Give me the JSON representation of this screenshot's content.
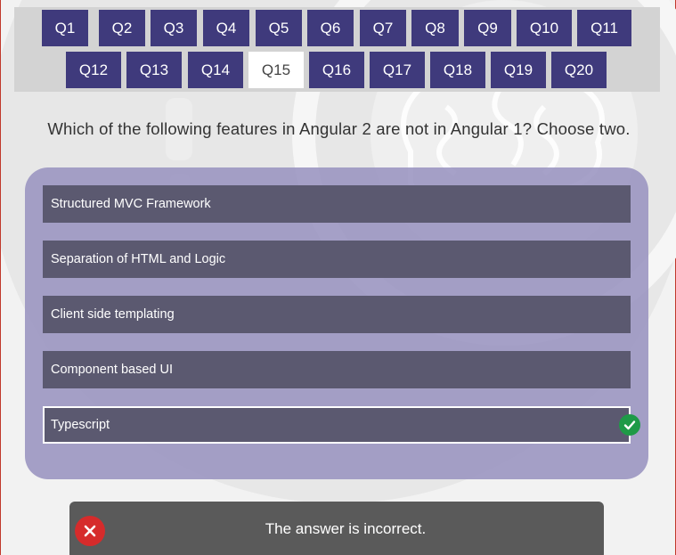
{
  "nav": {
    "row1": [
      "Q1",
      "Q2",
      "Q3",
      "Q4",
      "Q5",
      "Q6",
      "Q7",
      "Q8",
      "Q9",
      "Q10",
      "Q11"
    ],
    "row2": [
      "Q12",
      "Q13",
      "Q14",
      "Q15",
      "Q16",
      "Q17",
      "Q18",
      "Q19",
      "Q20"
    ],
    "active": "Q15"
  },
  "question": "Which of the following features in Angular 2 are not in Angular 1? Choose two.",
  "options": [
    "Structured MVC Framework",
    "Separation of HTML and Logic",
    "Client side templating",
    "Component based UI",
    "Typescript"
  ],
  "selected_option": "Typescript",
  "feedback": {
    "text": "The answer is incorrect."
  },
  "colors": {
    "nav_button": "#3f3a7c",
    "option_bg": "#5b5970",
    "panel_bg": "#9690be",
    "check": "#1e9a47",
    "error": "#d62b2b",
    "feedback_bg": "#5a5a5a"
  }
}
